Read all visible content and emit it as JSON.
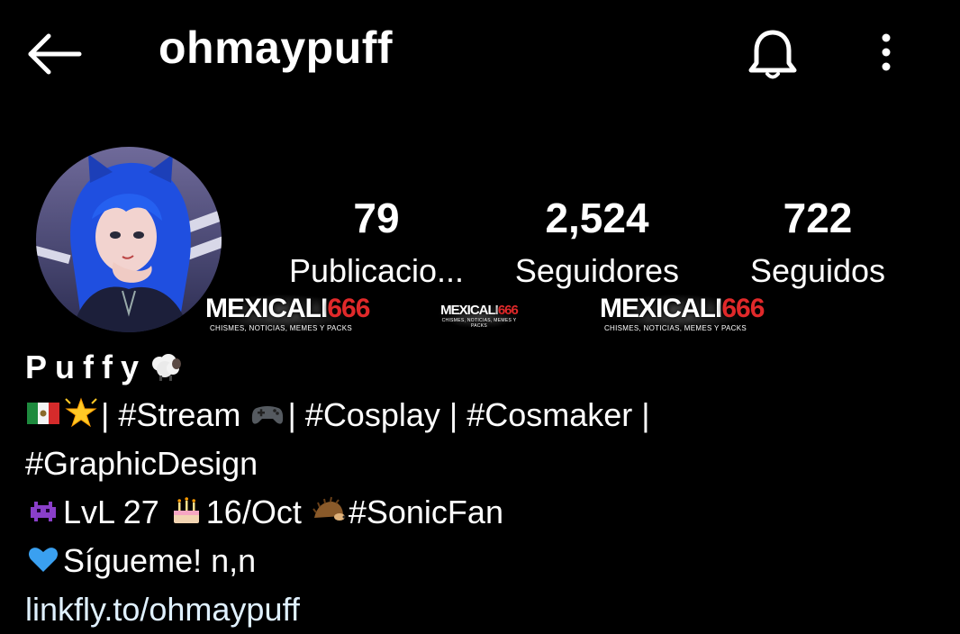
{
  "header": {
    "username": "ohmaypuff",
    "back_icon": "arrow-left-icon",
    "bell_icon": "bell-icon",
    "more_icon": "more-vertical-icon"
  },
  "stats": [
    {
      "value": "79",
      "label": "Publicacio..."
    },
    {
      "value": "2,524",
      "label": "Seguidores"
    },
    {
      "value": "722",
      "label": "Seguidos"
    }
  ],
  "watermark": {
    "brand_text": "MEXICALI",
    "brand_number": "666",
    "tagline": "CHISMES, NOTICIAS, MEMES Y PACKS"
  },
  "bio": {
    "name": "Puffy",
    "line1": "| #Stream",
    "line1b": "| #Cosplay | #Cosmaker |",
    "line2": "#GraphicDesign",
    "line3a": "LvL 27",
    "line3b": "16/Oct",
    "line3c": "#SonicFan",
    "line4": "Sígueme! n,n",
    "link": "linkfly.to/ohmaypuff"
  },
  "colors": {
    "background": "#000000",
    "text": "#ffffff",
    "link": "#e0f1ff",
    "avatar_hair": "#1f4fe0"
  }
}
